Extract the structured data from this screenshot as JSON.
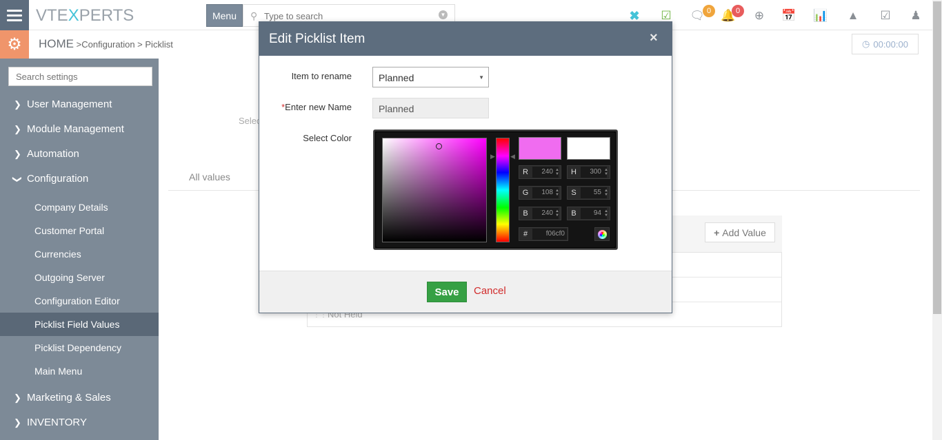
{
  "header": {
    "logo_prefix": "VTE",
    "logo_x": "X",
    "logo_suffix": "PERTS",
    "menu_label": "Menu",
    "search_placeholder": "Type to search",
    "chat_badge": "0",
    "notif_badge": "0",
    "icons": [
      "vtex-icon",
      "calendar-check-icon",
      "chat-icon",
      "bell-icon",
      "plus-circle-icon",
      "calendar-icon",
      "bar-chart-icon",
      "area-chart-icon",
      "checkbox-icon",
      "user-icon"
    ]
  },
  "breadcrumb": {
    "home": "HOME",
    "sep1": ">",
    "item1": "Configuration",
    "sep2": ">",
    "item2": "Picklist"
  },
  "timer": "00:00:00",
  "sidebar": {
    "search_placeholder": "Search settings",
    "sections": [
      {
        "label": "User Management"
      },
      {
        "label": "Module Management"
      },
      {
        "label": "Automation"
      },
      {
        "label": "Configuration"
      },
      {
        "label": "Marketing & Sales"
      },
      {
        "label": "INVENTORY"
      }
    ],
    "config_items": [
      {
        "label": "Company Details"
      },
      {
        "label": "Customer Portal"
      },
      {
        "label": "Currencies"
      },
      {
        "label": "Outgoing Server"
      },
      {
        "label": "Configuration Editor"
      },
      {
        "label": "Picklist Field Values"
      },
      {
        "label": "Picklist Dependency"
      },
      {
        "label": "Main Menu"
      }
    ]
  },
  "main": {
    "select_partial": "Selec",
    "tab_all_values": "All values",
    "add_value": "Add Value",
    "row_not_held": "Not Held"
  },
  "modal": {
    "title": "Edit Picklist Item",
    "close": "×",
    "item_to_rename_label": "Item to rename",
    "item_to_rename_value": "Planned",
    "required_mark": "*",
    "new_name_label": "Enter new Name",
    "new_name_value": "Planned",
    "select_color_label": "Select Color",
    "save": "Save",
    "cancel": "Cancel"
  },
  "colorpicker": {
    "new_color": "#f06cf0",
    "current_color": "#ffffff",
    "r": "240",
    "g": "108",
    "b": "240",
    "h": "300",
    "s": "55",
    "bv": "94",
    "hex": "f06cf0",
    "labels": {
      "r": "R",
      "g": "G",
      "b": "B",
      "h": "H",
      "s": "S",
      "bv": "B",
      "hash": "#"
    }
  }
}
